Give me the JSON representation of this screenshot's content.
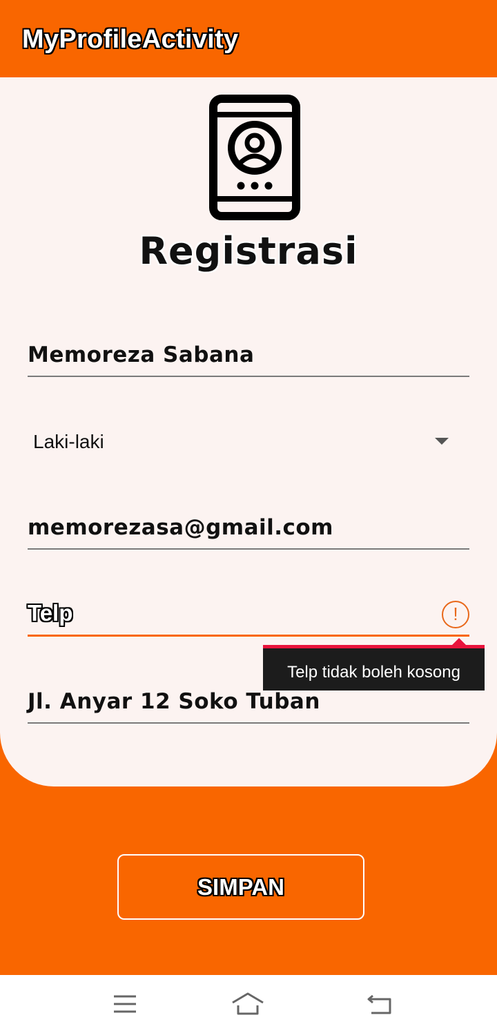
{
  "appbar": {
    "title": "MyProfileActivity"
  },
  "form": {
    "heading": "Registrasi",
    "logo_icon": "phone-profile-icon",
    "name_value": "Memoreza Sabana",
    "gender_selected": "Laki-laki",
    "email_value": "memorezasa@gmail.com",
    "telp_hint": "Telp",
    "telp_error": "Telp tidak boleh kosong",
    "address_value": "Jl. Anyar 12 Soko Tuban",
    "save_label": "SIMPAN"
  },
  "navbar": {
    "icons": [
      "menu-icon",
      "home-icon",
      "back-icon"
    ]
  },
  "colors": {
    "primary": "#F96600",
    "card": "#FCF3F1",
    "error_accent": "#E8143C",
    "error_icon": "#E8681A"
  }
}
